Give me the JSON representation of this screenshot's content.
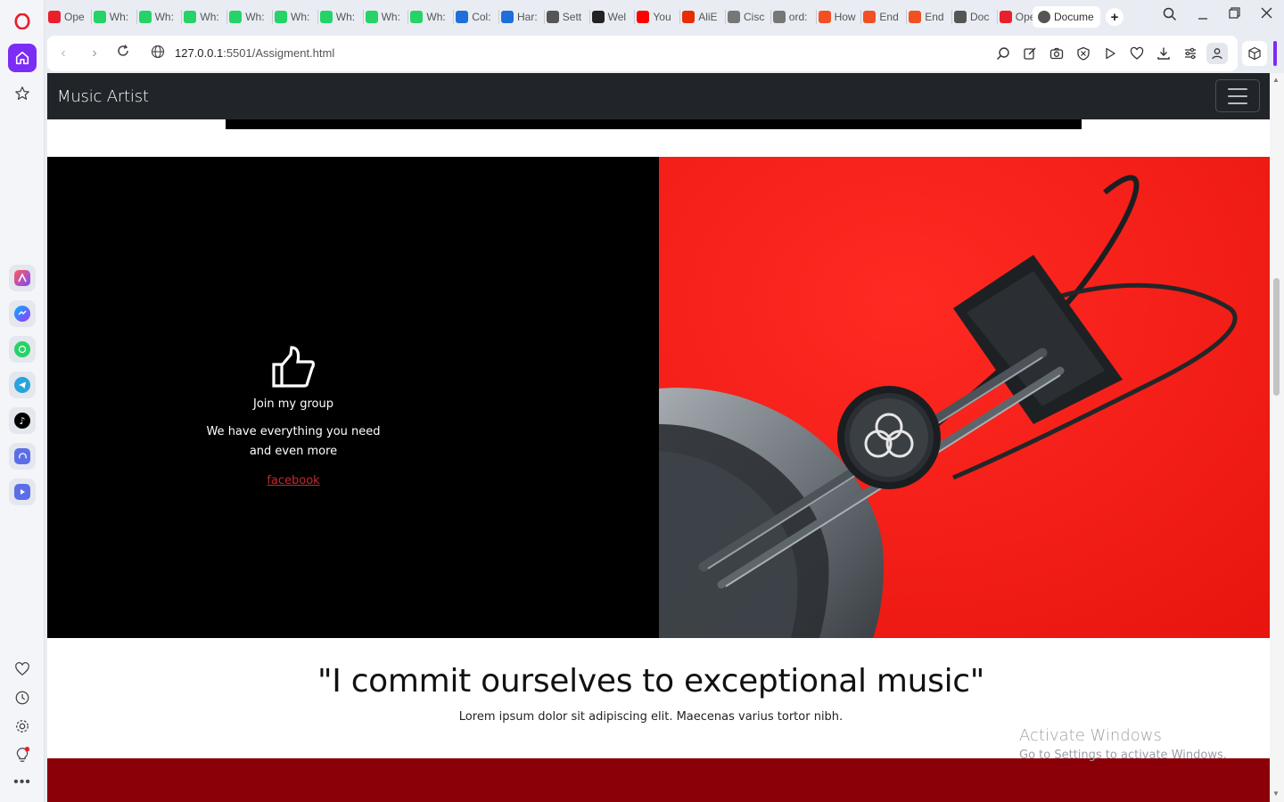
{
  "browser": {
    "tabs": [
      {
        "label": "Ope",
        "icon": "opera-icon",
        "color": "#e8202b"
      },
      {
        "label": "Wh:",
        "icon": "whatsapp-icon",
        "color": "#25d366"
      },
      {
        "label": "Wh:",
        "icon": "whatsapp-icon",
        "color": "#25d366"
      },
      {
        "label": "Wh:",
        "icon": "whatsapp-icon",
        "color": "#25d366"
      },
      {
        "label": "Wh:",
        "icon": "whatsapp-icon",
        "color": "#25d366"
      },
      {
        "label": "Wh:",
        "icon": "whatsapp-icon",
        "color": "#25d366"
      },
      {
        "label": "Wh:",
        "icon": "whatsapp-icon",
        "color": "#25d366"
      },
      {
        "label": "Wh:",
        "icon": "whatsapp-icon",
        "color": "#25d366"
      },
      {
        "label": "Wh:",
        "icon": "whatsapp-icon",
        "color": "#25d366"
      },
      {
        "label": "Col:",
        "icon": "codepen-icon",
        "color": "#1e6fd9"
      },
      {
        "label": "Har:",
        "icon": "codepen-icon",
        "color": "#1e6fd9"
      },
      {
        "label": "Sett",
        "icon": "gear-icon",
        "color": "#555555"
      },
      {
        "label": "Wel",
        "icon": "amazon-icon",
        "color": "#222222"
      },
      {
        "label": "You",
        "icon": "youtube-icon",
        "color": "#ff0000"
      },
      {
        "label": "AliE",
        "icon": "aliexpress-icon",
        "color": "#e62e04"
      },
      {
        "label": "Cisc",
        "icon": "document-icon",
        "color": "#777777"
      },
      {
        "label": "ord:",
        "icon": "document-icon",
        "color": "#777777"
      },
      {
        "label": "How",
        "icon": "microsoft-icon",
        "color": "#f25022"
      },
      {
        "label": "End",
        "icon": "microsoft-icon",
        "color": "#f25022"
      },
      {
        "label": "End",
        "icon": "microsoft-icon",
        "color": "#f25022"
      },
      {
        "label": "Doc",
        "icon": "globe-icon",
        "color": "#555555"
      },
      {
        "label": "Ope",
        "icon": "opera-icon",
        "color": "#e8202b"
      }
    ],
    "active_tab": {
      "label": "Docume",
      "icon": "globe-icon"
    },
    "url_host": "127.0.0.1",
    "url_path": ":5501/Assigment.html"
  },
  "page": {
    "brand": "Music Artist",
    "promo": {
      "title": "Join my group",
      "text_line1": "We have everything you need",
      "text_line2": "and even more",
      "link": "facebook"
    },
    "quote": "\"I commit ourselves to exceptional music\"",
    "quote_sub": "Lorem ipsum dolor sit adipiscing elit. Maecenas varius tortor nibh."
  },
  "watermark": {
    "line1": "Activate Windows",
    "line2": "Go to Settings to activate Windows."
  },
  "colors": {
    "accent": "#7b2cf5",
    "navbar": "#212529",
    "promo_red": "#f1221f",
    "footer_red": "#8b0008",
    "link_red": "#c4282f"
  }
}
